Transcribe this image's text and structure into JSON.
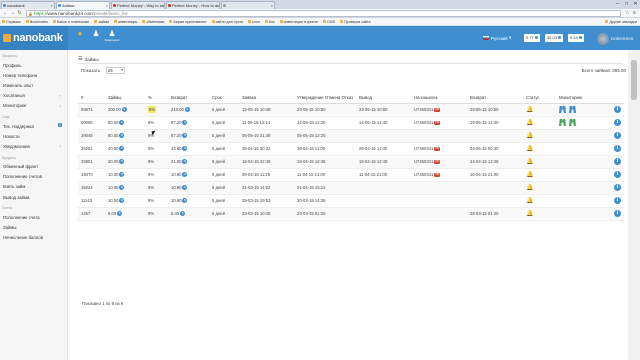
{
  "browser": {
    "tabs": [
      {
        "label": "nanobank",
        "favicon_color": "#3e8ed0",
        "active": false
      },
      {
        "label": "Займы",
        "favicon_color": "#3e8ed0",
        "active": true
      },
      {
        "label": "Perfect Money - Way to sle",
        "favicon_color": "#d52b1e",
        "active": false
      },
      {
        "label": "Perfect Money - How to do",
        "favicon_color": "#d52b1e",
        "active": false
      },
      {
        "label": "",
        "favicon_color": "#999999",
        "active": false
      }
    ],
    "url_scheme": "https://",
    "url_host": "www.nanobank24.com",
    "url_path": "/private/loans_list",
    "bookmarks": [
      "Сервисы",
      "Bookmarks",
      "Банки и платежные",
      "займы",
      "инвестиции",
      "обменники",
      "Биржи криптовалют",
      "сайты для проги",
      "хлоп",
      "биз",
      "инвестиции в крипте",
      "CMS",
      "Проверка сайта"
    ],
    "other_bookmarks": "Другие закладки"
  },
  "app": {
    "logo": "nanobank",
    "nav_icons": [
      {
        "icon": "coins-icon",
        "label": ""
      },
      {
        "icon": "user-icon",
        "label": ""
      },
      {
        "icon": "users-icon",
        "label": "Заявления"
      }
    ],
    "language": "Русский",
    "balances": [
      "0.77",
      "35.03",
      "0.15"
    ],
    "username": "DOBOSSSS"
  },
  "sidebar": {
    "sections": [
      {
        "title": "Профиль",
        "items": [
          {
            "label": "Профиль"
          },
          {
            "label": "Номер телефона"
          },
          {
            "label": "Изменить опыт"
          },
          {
            "label": "Хосатаныя",
            "chevron": true
          },
          {
            "label": "Мониторинг",
            "chevron": true
          }
        ]
      },
      {
        "title": "Саф",
        "items": [
          {
            "label": "Тех. поддержка",
            "badge": "1"
          },
          {
            "label": "Новости"
          },
          {
            "label": "Уведомления",
            "chevron": true
          }
        ]
      },
      {
        "title": "Кредиты",
        "items": [
          {
            "label": "Обменный франт"
          },
          {
            "label": "Пополнение счетов"
          },
          {
            "label": "Взять займ"
          },
          {
            "label": "Вывод займа"
          }
        ]
      },
      {
        "title": "Счета",
        "items": [
          {
            "label": "Пополнение счета"
          },
          {
            "label": "Займы"
          },
          {
            "label": "Начисление баллов"
          }
        ]
      }
    ]
  },
  "page": {
    "breadcrumb": "Займы",
    "show_label": "Показать",
    "show_value": "25",
    "total": "Всего займов: 355.00",
    "columns": [
      "#",
      "Займы",
      "%",
      "Возврат",
      "Срок",
      "Заявка",
      "Утверждение Отмена Отказ",
      "Вывод",
      "На кошелек",
      "Возврат",
      "Статус",
      "Мониторинг",
      ""
    ],
    "rows": [
      {
        "id": "59871",
        "amount": "200.00",
        "pct": "5%",
        "ret": "210.00",
        "term": "5 дней",
        "app": "19-05-15 10:48",
        "appr": "23-05-15 10:50",
        "out": "23-05-15 10:50",
        "wallet": "U7450341",
        "ret_date": "28-05-15 10:50",
        "status": "green",
        "mon": [
          "blue",
          "blue"
        ],
        "pct_hl": true
      },
      {
        "id": "00095",
        "amount": "80.00",
        "pct": "9%",
        "ret": "87.20",
        "term": "5 дней",
        "app": "11-05-15 12:14",
        "appr": "14-05-15 12:20",
        "out": "14-05-15 12:40",
        "wallet": "U7450341",
        "ret_date": "19-05-15 12:40",
        "status": "orange",
        "mon": [
          "green",
          "green"
        ]
      },
      {
        "id": "29045",
        "amount": "80.00",
        "pct": "9%",
        "ret": "87.20",
        "term": "5 дней",
        "app": "06-05-15 21:48",
        "appr": "05-05-15 12:20",
        "out": "",
        "wallet": "",
        "ret_date": "",
        "status": "red",
        "mon": []
      },
      {
        "id": "26261",
        "amount": "40.00",
        "pct": "9%",
        "ret": "43.60",
        "term": "5 дней",
        "app": "25-04-15 00:22",
        "appr": "28-04-15 11:00",
        "out": "28-04-15 11:00",
        "wallet": "U7450341",
        "ret_date": "03-05-15 00:30",
        "status": "red",
        "mon": []
      },
      {
        "id": "25801",
        "amount": "20.00",
        "pct": "9%",
        "ret": "21.80",
        "term": "5 дней",
        "app": "16-04-15 22:49",
        "appr": "19-04-15 12:48",
        "out": "19-04-15 12:48",
        "wallet": "U7450341",
        "ret_date": "24-04-15 12:48",
        "status": "red",
        "mon": []
      },
      {
        "id": "19470",
        "amount": "10.00",
        "pct": "9%",
        "ret": "10.90",
        "term": "5 дней",
        "app": "08-04-15 11:25",
        "appr": "11-04-15 21:00",
        "out": "11-04-15 21:00",
        "wallet": "U7450341",
        "ret_date": "16-04-15 21:00",
        "status": "red",
        "mon": []
      },
      {
        "id": "15024",
        "amount": "10.00",
        "pct": "9%",
        "ret": "10.90",
        "term": "5 дней",
        "app": "31-03-15 14:02",
        "appr": "01-04-15 15:12",
        "out": "",
        "wallet": "",
        "ret_date": "",
        "status": "red",
        "mon": []
      },
      {
        "id": "11143",
        "amount": "10.00",
        "pct": "9%",
        "ret": "10.90",
        "term": "5 дней",
        "app": "29-03-15 19:53",
        "appr": "30-03-15 14:38",
        "out": "",
        "wallet": "",
        "ret_date": "",
        "status": "red",
        "mon": []
      },
      {
        "id": "1457",
        "amount": "5.00",
        "pct": "9%",
        "ret": "5.45",
        "term": "5 дней",
        "app": "23-03-15 10:45",
        "appr": "23-03-15 01:20",
        "out": "",
        "wallet": "",
        "ret_date": "28-03-15 01:20",
        "status": "red",
        "mon": []
      }
    ],
    "footer": "Показано 1 по 9 из 9"
  },
  "colors": {
    "primary": "#3e8ed0",
    "status_green": "#54a84a",
    "status_red": "#d9453b",
    "status_orange": "#e98b3a",
    "highlight": "#f5e663"
  }
}
